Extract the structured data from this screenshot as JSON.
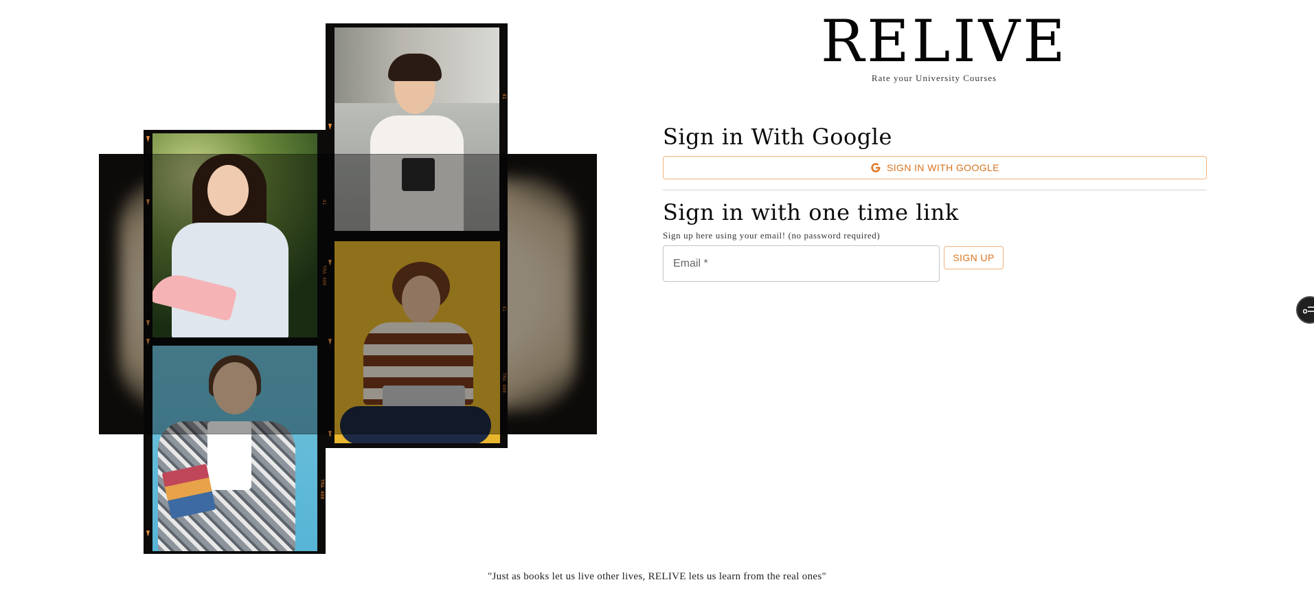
{
  "brand": {
    "title": "RELIVE",
    "subtitle": "Rate your University Courses"
  },
  "google_section": {
    "title": "Sign in With Google",
    "button_label": "SIGN IN WITH GOOGLE",
    "icon": "google-icon"
  },
  "link_section": {
    "title": "Sign in with one time link",
    "helper": "Sign up here using your email! (no password required)",
    "email_placeholder": "Email *",
    "email_value": "",
    "signup_label": "SIGN UP"
  },
  "film": {
    "edge_codes": [
      "41",
      "TRA 400",
      "41",
      "TRA 400",
      "TRA 400",
      "41"
    ]
  },
  "footer": {
    "quote": "\"Just as books let us live other lives, RELIVE lets us learn from the real ones\""
  },
  "colors": {
    "accent": "#d9731e",
    "accent_border": "#f1b27a",
    "film_dark": "#0c0b0a",
    "film_glow": "#ead9bf"
  }
}
